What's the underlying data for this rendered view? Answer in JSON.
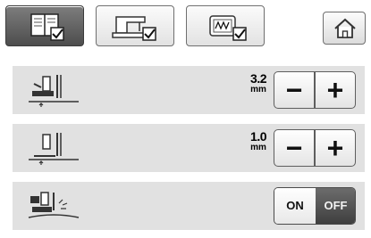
{
  "tabs": [
    {
      "name": "tab-settings-general",
      "icon": "settings-book-icon",
      "active": true
    },
    {
      "name": "tab-settings-sewing",
      "icon": "sewing-machine-icon",
      "active": false
    },
    {
      "name": "tab-settings-embroidery",
      "icon": "embroidery-frame-icon",
      "active": false
    }
  ],
  "home_button": {
    "icon": "home-icon"
  },
  "rows": [
    {
      "icon": "presser-foot-height-icon",
      "value": "3.2",
      "unit": "mm"
    },
    {
      "icon": "presser-foot-pressure-icon",
      "value": "1.0",
      "unit": "mm"
    },
    {
      "icon": "pivot-sensor-icon",
      "toggle": {
        "on_label": "ON",
        "off_label": "OFF",
        "selected": "OFF"
      }
    }
  ],
  "stepper": {
    "minus": "−",
    "plus": "+"
  },
  "colors": {
    "row_bg": "#e1e1e1",
    "active_tab": "#5a5a5a",
    "toggle_off_bg": "#4a4a4a"
  }
}
